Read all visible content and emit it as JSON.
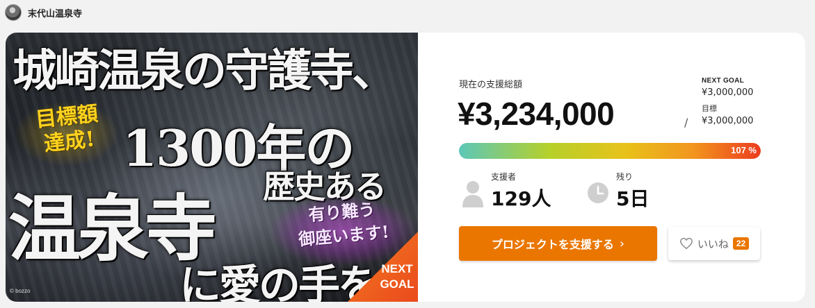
{
  "owner": {
    "name": "末代山温泉寺",
    "avatar_icon": "temple-avatar"
  },
  "hero": {
    "headline_1": "城崎温泉の守護寺、",
    "headline_2": "1300年の",
    "headline_3": "歴史ある",
    "headline_4": "温泉寺",
    "headline_5": "に愛の手を",
    "badge_goal_reached_1": "目標額",
    "badge_goal_reached_2": "達成!",
    "badge_thanks_1": "有り難う",
    "badge_thanks_2": "御座います!",
    "corner_next_1": "NEXT",
    "corner_next_2": "GOAL",
    "copyright": "© bozzo"
  },
  "funding": {
    "label": "現在の支援総額",
    "amount": "¥3,234,000",
    "slash": "/",
    "next_goal_label": "NEXT GOAL",
    "next_goal_value": "¥3,000,000",
    "target_label": "目標",
    "target_value": "¥3,000,000",
    "progress_percent": 107,
    "progress_text": "107 %"
  },
  "stats": {
    "supporters_label": "支援者",
    "supporters_value": "129人",
    "remaining_label": "残り",
    "remaining_value": "5日"
  },
  "actions": {
    "support_label": "プロジェクトを支援する",
    "support_chevron": "›",
    "like_label": "いいね",
    "like_count": "22"
  },
  "colors": {
    "accent": "#ea7600",
    "progress_start": "#5cc7b9",
    "progress_end": "#ec3c1e"
  }
}
